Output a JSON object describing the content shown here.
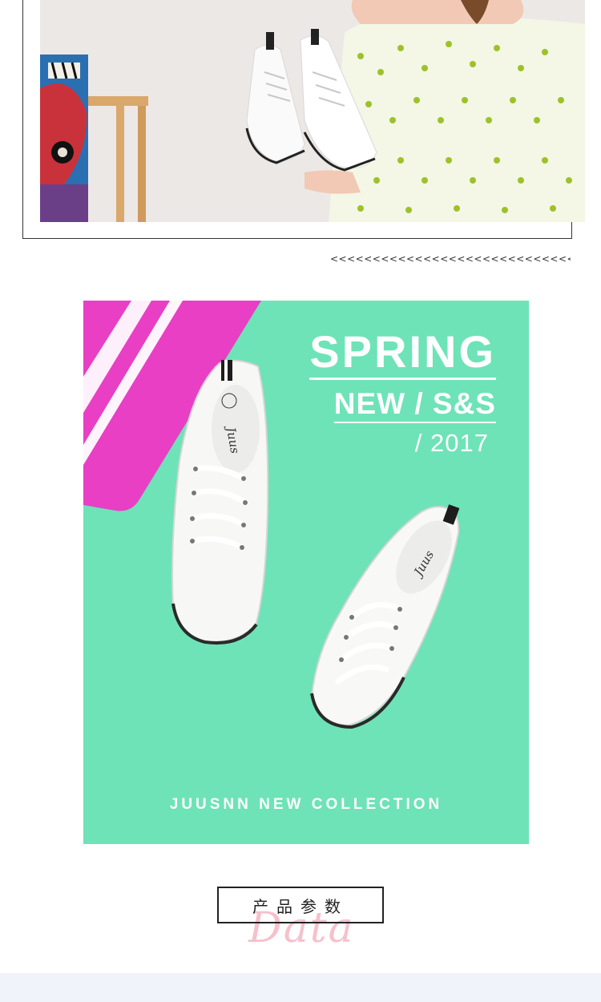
{
  "top_section": {
    "arrows": "<<<<<<<<<<<<<<<<<<<<<<<<<<<<<<"
  },
  "hero": {
    "headline_line1": "SPRING",
    "headline_line2": "NEW / S&S",
    "year": "/ 2017",
    "collection": "JUUSNN NEW COLLECTION",
    "shoe_brand": "Juus",
    "shoe_badge": "JUUS",
    "background_color": "#6ee3b7",
    "accent_color": "#e83fc4"
  },
  "section_heading": {
    "title": "产品参数",
    "decoration": "Data"
  }
}
